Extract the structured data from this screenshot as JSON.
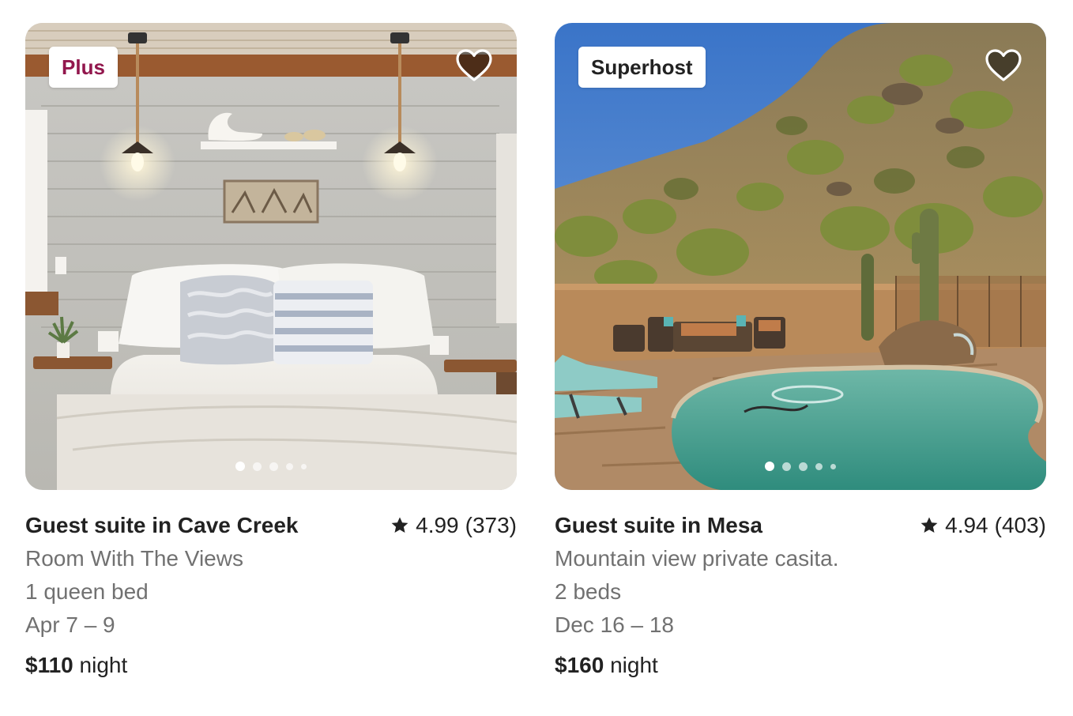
{
  "colors": {
    "text_primary": "#222222",
    "text_secondary": "#717171",
    "plus_badge": "#92174d"
  },
  "listings": [
    {
      "badge": "Plus",
      "title": "Guest suite in Cave Creek",
      "rating": "4.99",
      "reviews": "(373)",
      "description": "Room With The Views",
      "beds": "1 queen bed",
      "dates": "Apr 7 – 9",
      "price": "$110",
      "price_unit": "night",
      "photo_icon": "bedroom-photo",
      "favorite_icon": "heart-icon",
      "photo_count_dots": 5,
      "active_photo": 1
    },
    {
      "badge": "Superhost",
      "title": "Guest suite in Mesa",
      "rating": "4.94",
      "reviews": "(403)",
      "description": "Mountain view private casita.",
      "beds": "2 beds",
      "dates": "Dec 16 – 18",
      "price": "$160",
      "price_unit": "night",
      "photo_icon": "desert-pool-photo",
      "favorite_icon": "heart-icon",
      "photo_count_dots": 5,
      "active_photo": 1
    }
  ]
}
